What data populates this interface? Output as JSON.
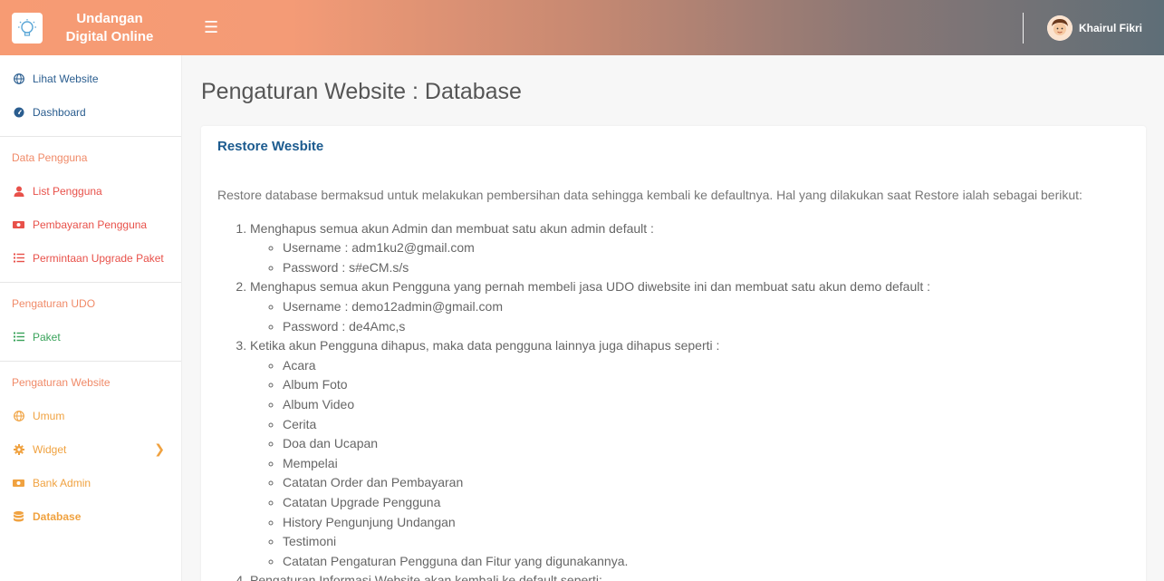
{
  "header": {
    "brand_line1": "Undangan",
    "brand_line2": "Digital Online",
    "user_name": "Khairul Fikri"
  },
  "sidebar": {
    "top_items": [
      {
        "label": "Lihat Website",
        "icon": "globe-icon"
      },
      {
        "label": "Dashboard",
        "icon": "dashboard-icon"
      }
    ],
    "section_data_pengguna": "Data Pengguna",
    "data_pengguna_items": [
      {
        "label": "List Pengguna",
        "icon": "user-icon"
      },
      {
        "label": "Pembayaran Pengguna",
        "icon": "money-icon"
      },
      {
        "label": "Permintaan Upgrade Paket",
        "icon": "list-icon"
      }
    ],
    "section_pengaturan_udo": "Pengaturan UDO",
    "pengaturan_udo_items": [
      {
        "label": "Paket",
        "icon": "list-icon"
      }
    ],
    "section_pengaturan_website": "Pengaturan Website",
    "pengaturan_website_items": [
      {
        "label": "Umum",
        "icon": "globe-icon"
      },
      {
        "label": "Widget",
        "icon": "gear-icon"
      },
      {
        "label": "Bank Admin",
        "icon": "money-icon"
      },
      {
        "label": "Database",
        "icon": "database-icon"
      }
    ]
  },
  "main": {
    "page_title": "Pengaturan Website : Database",
    "card_title": "Restore Wesbite",
    "intro": "Restore database bermaksud untuk melakukan pembersihan data sehingga kembali ke defaultnya. Hal yang dilakukan saat Restore ialah sebagai berikut:",
    "steps": [
      {
        "text": "Menghapus semua akun Admin dan membuat satu akun admin default :",
        "sub": [
          "Username : adm1ku2@gmail.com",
          "Password : s#eCM.s/s"
        ]
      },
      {
        "text": "Menghapus semua akun Pengguna yang pernah membeli jasa UDO diwebsite ini dan membuat satu akun demo default :",
        "sub": [
          "Username : demo12admin@gmail.com",
          "Password : de4Amc,s"
        ]
      },
      {
        "text": "Ketika akun Pengguna dihapus, maka data pengguna lainnya juga dihapus seperti :",
        "sub": [
          "Acara",
          "Album Foto",
          "Album Video",
          "Cerita",
          "Doa dan Ucapan",
          "Mempelai",
          "Catatan Order dan Pembayaran",
          "Catatan Upgrade Pengguna",
          "History Pengunjung Undangan",
          "Testimoni",
          "Catatan Pengaturan Pengguna dan Fitur yang digunakannya."
        ]
      },
      {
        "text": "Pengaturan Informasi Website akan kembali ke default seperti:",
        "sub": []
      }
    ]
  }
}
